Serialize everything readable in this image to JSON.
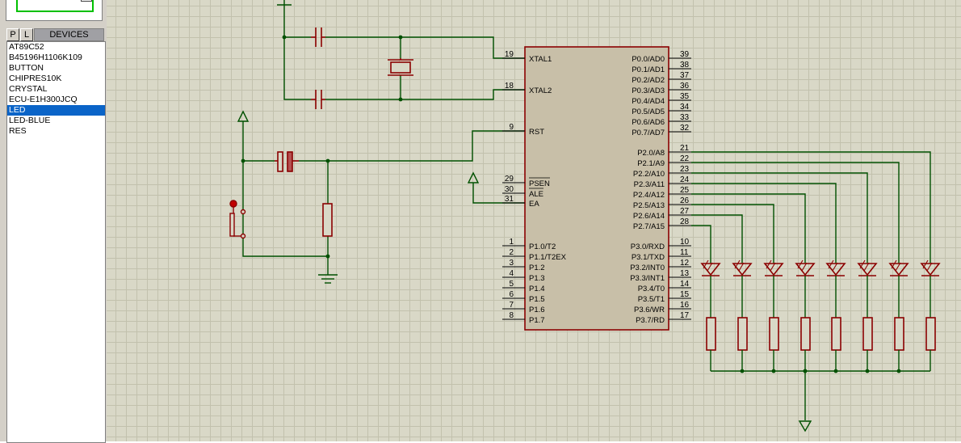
{
  "panel": {
    "p_label": "P",
    "l_label": "L",
    "devices_title": "DEVICES",
    "devices": [
      "AT89C52",
      "B45196H1106K109",
      "BUTTON",
      "CHIPRES10K",
      "CRYSTAL",
      "ECU-E1H300JCQ",
      "LED",
      "LED-BLUE",
      "RES"
    ],
    "selected_device": "LED"
  },
  "chip": {
    "left_pins": [
      {
        "num": "19",
        "name": "XTAL1"
      },
      {
        "num": "18",
        "name": "XTAL2"
      },
      {
        "num": "9",
        "name": "RST"
      },
      {
        "num": "29",
        "name": "PSEN"
      },
      {
        "num": "30",
        "name": "ALE"
      },
      {
        "num": "31",
        "name": "EA"
      },
      {
        "num": "1",
        "name": "P1.0/T2"
      },
      {
        "num": "2",
        "name": "P1.1/T2EX"
      },
      {
        "num": "3",
        "name": "P1.2"
      },
      {
        "num": "4",
        "name": "P1.3"
      },
      {
        "num": "5",
        "name": "P1.4"
      },
      {
        "num": "6",
        "name": "P1.5"
      },
      {
        "num": "7",
        "name": "P1.6"
      },
      {
        "num": "8",
        "name": "P1.7"
      }
    ],
    "right_pins": [
      {
        "num": "39",
        "name": "P0.0/AD0"
      },
      {
        "num": "38",
        "name": "P0.1/AD1"
      },
      {
        "num": "37",
        "name": "P0.2/AD2"
      },
      {
        "num": "36",
        "name": "P0.3/AD3"
      },
      {
        "num": "35",
        "name": "P0.4/AD4"
      },
      {
        "num": "34",
        "name": "P0.5/AD5"
      },
      {
        "num": "33",
        "name": "P0.6/AD6"
      },
      {
        "num": "32",
        "name": "P0.7/AD7"
      },
      {
        "num": "21",
        "name": "P2.0/A8"
      },
      {
        "num": "22",
        "name": "P2.1/A9"
      },
      {
        "num": "23",
        "name": "P2.2/A10"
      },
      {
        "num": "24",
        "name": "P2.3/A11"
      },
      {
        "num": "25",
        "name": "P2.4/A12"
      },
      {
        "num": "26",
        "name": "P2.5/A13"
      },
      {
        "num": "27",
        "name": "P2.6/A14"
      },
      {
        "num": "28",
        "name": "P2.7/A15"
      },
      {
        "num": "10",
        "name": "P3.0/RXD"
      },
      {
        "num": "11",
        "name": "P3.1/TXD"
      },
      {
        "num": "12",
        "name": "P3.2/INT0"
      },
      {
        "num": "13",
        "name": "P3.3/INT1"
      },
      {
        "num": "14",
        "name": "P3.4/T0"
      },
      {
        "num": "15",
        "name": "P3.5/T1"
      },
      {
        "num": "16",
        "name": "P3.6/WR"
      },
      {
        "num": "17",
        "name": "P3.7/RD"
      }
    ]
  },
  "colors": {
    "wire": "#005000",
    "component": "#8b0000",
    "chip_fill": "#c8bfa8",
    "selected": "#0a64c8"
  }
}
